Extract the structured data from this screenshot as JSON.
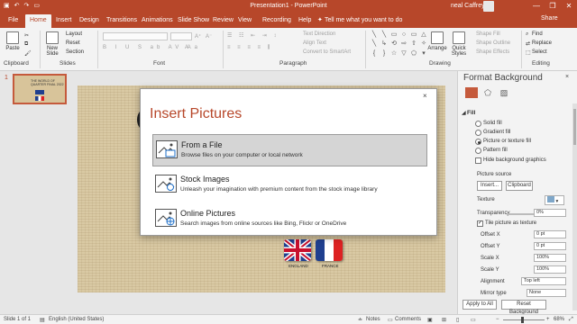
{
  "titlebar": {
    "title": "Presentation1 - PowerPoint",
    "user": "neal Caffrey",
    "minimize": "—",
    "restore": "❐",
    "close": "✕"
  },
  "tabs": [
    "File",
    "Home",
    "Insert",
    "Design",
    "Transitions",
    "Animations",
    "Slide Show",
    "Review",
    "View",
    "Recording",
    "Help"
  ],
  "tellme": "Tell me what you want to do",
  "share": "Share",
  "ribbon": {
    "paste": "Paste",
    "new_slide": "New Slide",
    "layout": "Layout",
    "reset": "Reset",
    "section": "Section",
    "text_direction": "Text Direction",
    "align_text": "Align Text",
    "convert_smartart": "Convert to SmartArt",
    "arrange": "Arrange",
    "quick_styles": "Quick Styles",
    "shape_fill": "Shape Fill",
    "shape_outline": "Shape Outline",
    "shape_effects": "Shape Effects",
    "find": "Find",
    "replace": "Replace",
    "select": "Select",
    "groups": {
      "clipboard": "Clipboard",
      "slides": "Slides",
      "font": "Font",
      "paragraph": "Paragraph",
      "drawing": "Drawing",
      "editing": "Editing"
    }
  },
  "left_pane": {
    "slide_number": "1",
    "thumb_title": "THE WORLD OF QUARTER FINAL 2022"
  },
  "slide": {
    "flag1_label": "ENGLAND",
    "flag2_label": "FRANCE"
  },
  "dialog": {
    "title": "Insert Pictures",
    "close": "×",
    "options": [
      {
        "title": "From a File",
        "desc": "Browse files on your computer or local network"
      },
      {
        "title": "Stock Images",
        "desc": "Unleash your imagination with premium content from the stock image library"
      },
      {
        "title": "Online Pictures",
        "desc": "Search images from online sources like Bing, Flickr or OneDrive"
      }
    ]
  },
  "format_pane": {
    "title": "Format Background",
    "close": "×",
    "fill_header": "Fill",
    "fill_options": [
      "Solid fill",
      "Gradient fill",
      "Picture or texture fill",
      "Pattern fill"
    ],
    "selected_fill": "Picture or texture fill",
    "hide_bg": "Hide background graphics",
    "picture_source": "Picture source",
    "insert_btn": "Insert...",
    "clipboard_btn": "Clipboard",
    "texture": "Texture",
    "transparency": "Transparency",
    "transparency_value": "0%",
    "tile": "Tile picture as texture",
    "tile_checked": true,
    "offset_x": "Offset X",
    "offset_x_value": "0 pt",
    "offset_y": "Offset Y",
    "offset_y_value": "0 pt",
    "scale_x": "Scale X",
    "scale_x_value": "100%",
    "scale_y": "Scale Y",
    "scale_y_value": "100%",
    "alignment": "Alignment",
    "alignment_value": "Top left",
    "mirror_type": "Mirror type",
    "mirror_value": "None",
    "apply_all": "Apply to All",
    "reset_bg": "Reset Background"
  },
  "status": {
    "slide": "Slide 1 of 1",
    "language": "English (United States)",
    "notes": "Notes",
    "comments": "Comments",
    "zoom": "68%"
  },
  "colors": {
    "accent": "#b7472a",
    "selected_option": "#d5d5d5"
  }
}
